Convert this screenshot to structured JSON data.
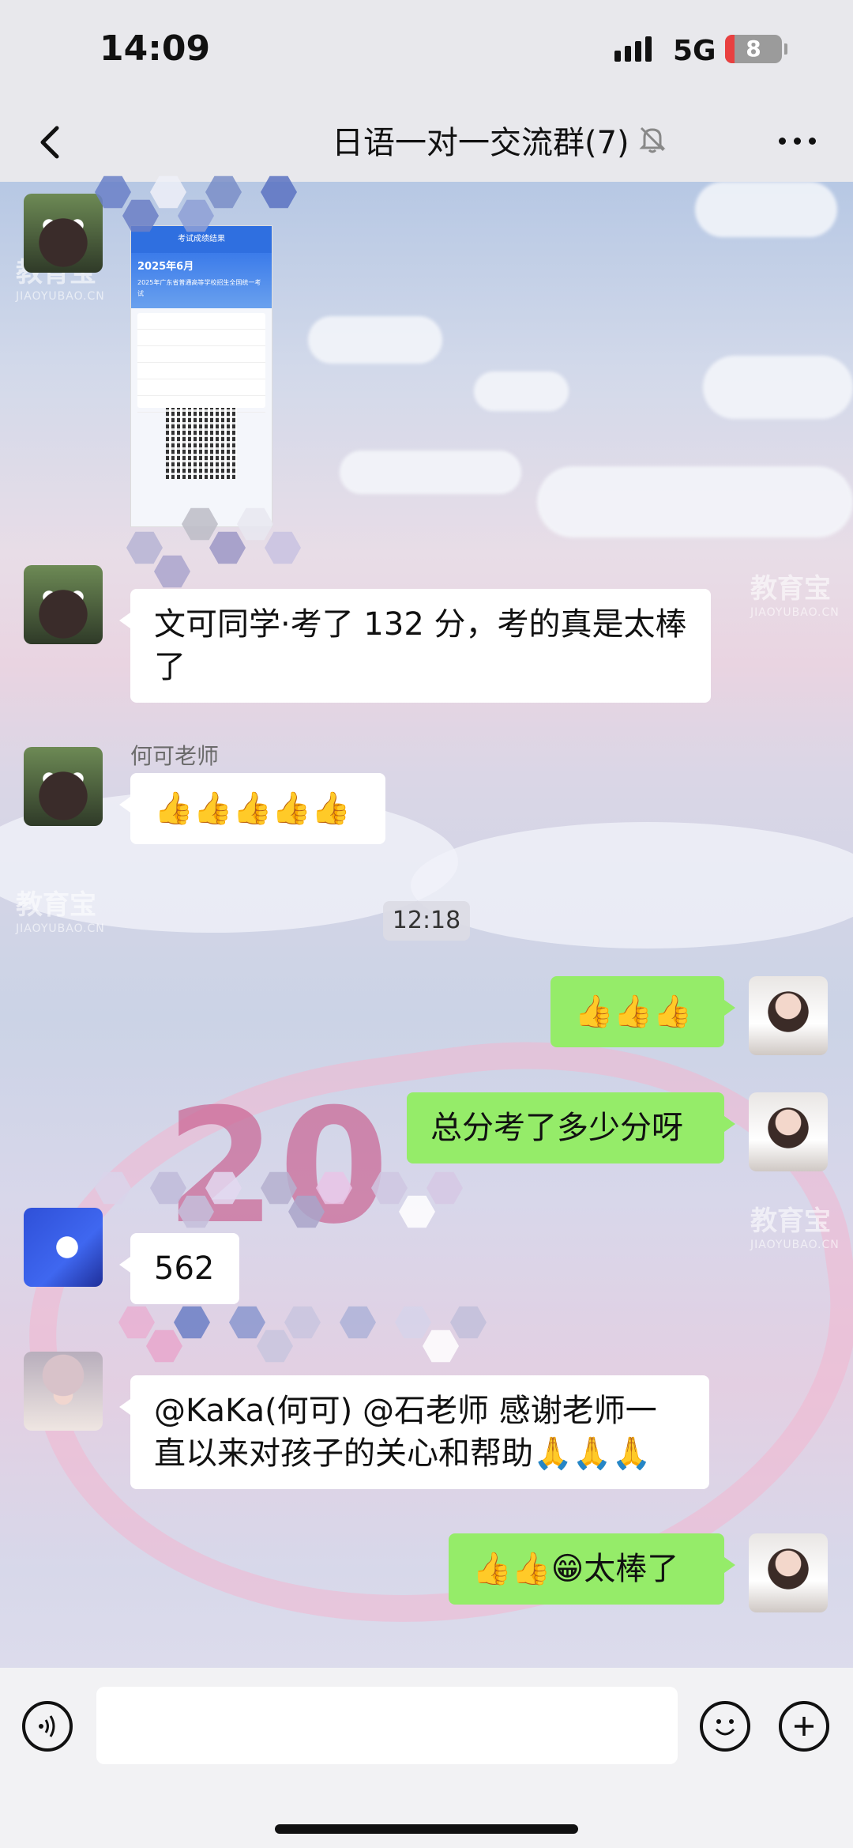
{
  "status_bar": {
    "time": "14:09",
    "network": "5G",
    "battery": "8"
  },
  "nav": {
    "title": "日语一对一交流群(7)",
    "back_icon": "chevron-left-icon",
    "mute_icon": "bell-slash-icon",
    "more_icon": "more-dots-icon"
  },
  "watermark": {
    "text": "教育宝",
    "sub": "JIAOYUBAO.CN"
  },
  "score_image": {
    "header_bar": "考试成绩结果",
    "date": "2025年6月",
    "desc": "2025年广东省普通高等学校招生全国统一考试"
  },
  "messages": [
    {
      "id": "m1",
      "direction": "in",
      "text": "文可同学·考了 132 分，考的真是太棒了"
    },
    {
      "id": "m2",
      "direction": "in",
      "sender": "何可老师",
      "text": "👍👍👍👍👍"
    },
    {
      "id": "ts1",
      "type": "timestamp",
      "text": "12:18"
    },
    {
      "id": "m3",
      "direction": "out",
      "text": "👍👍👍"
    },
    {
      "id": "m4",
      "direction": "out",
      "text": "总分考了多少分呀"
    },
    {
      "id": "m5",
      "direction": "in",
      "text": "562"
    },
    {
      "id": "m6",
      "direction": "in",
      "text": "@KaKa(何可) @石老师 感谢老师一直以来对孩子的关心和帮助🙏🙏🙏"
    },
    {
      "id": "m7",
      "direction": "out",
      "text": "👍👍😁太棒了"
    }
  ],
  "bottom_bar": {
    "voice_icon": "voice-icon",
    "emoji_icon": "smiley-icon",
    "add_icon": "plus-circle-icon",
    "input_value": ""
  },
  "colors": {
    "out_bubble": "#95ec69",
    "in_bubble": "#ffffff"
  }
}
